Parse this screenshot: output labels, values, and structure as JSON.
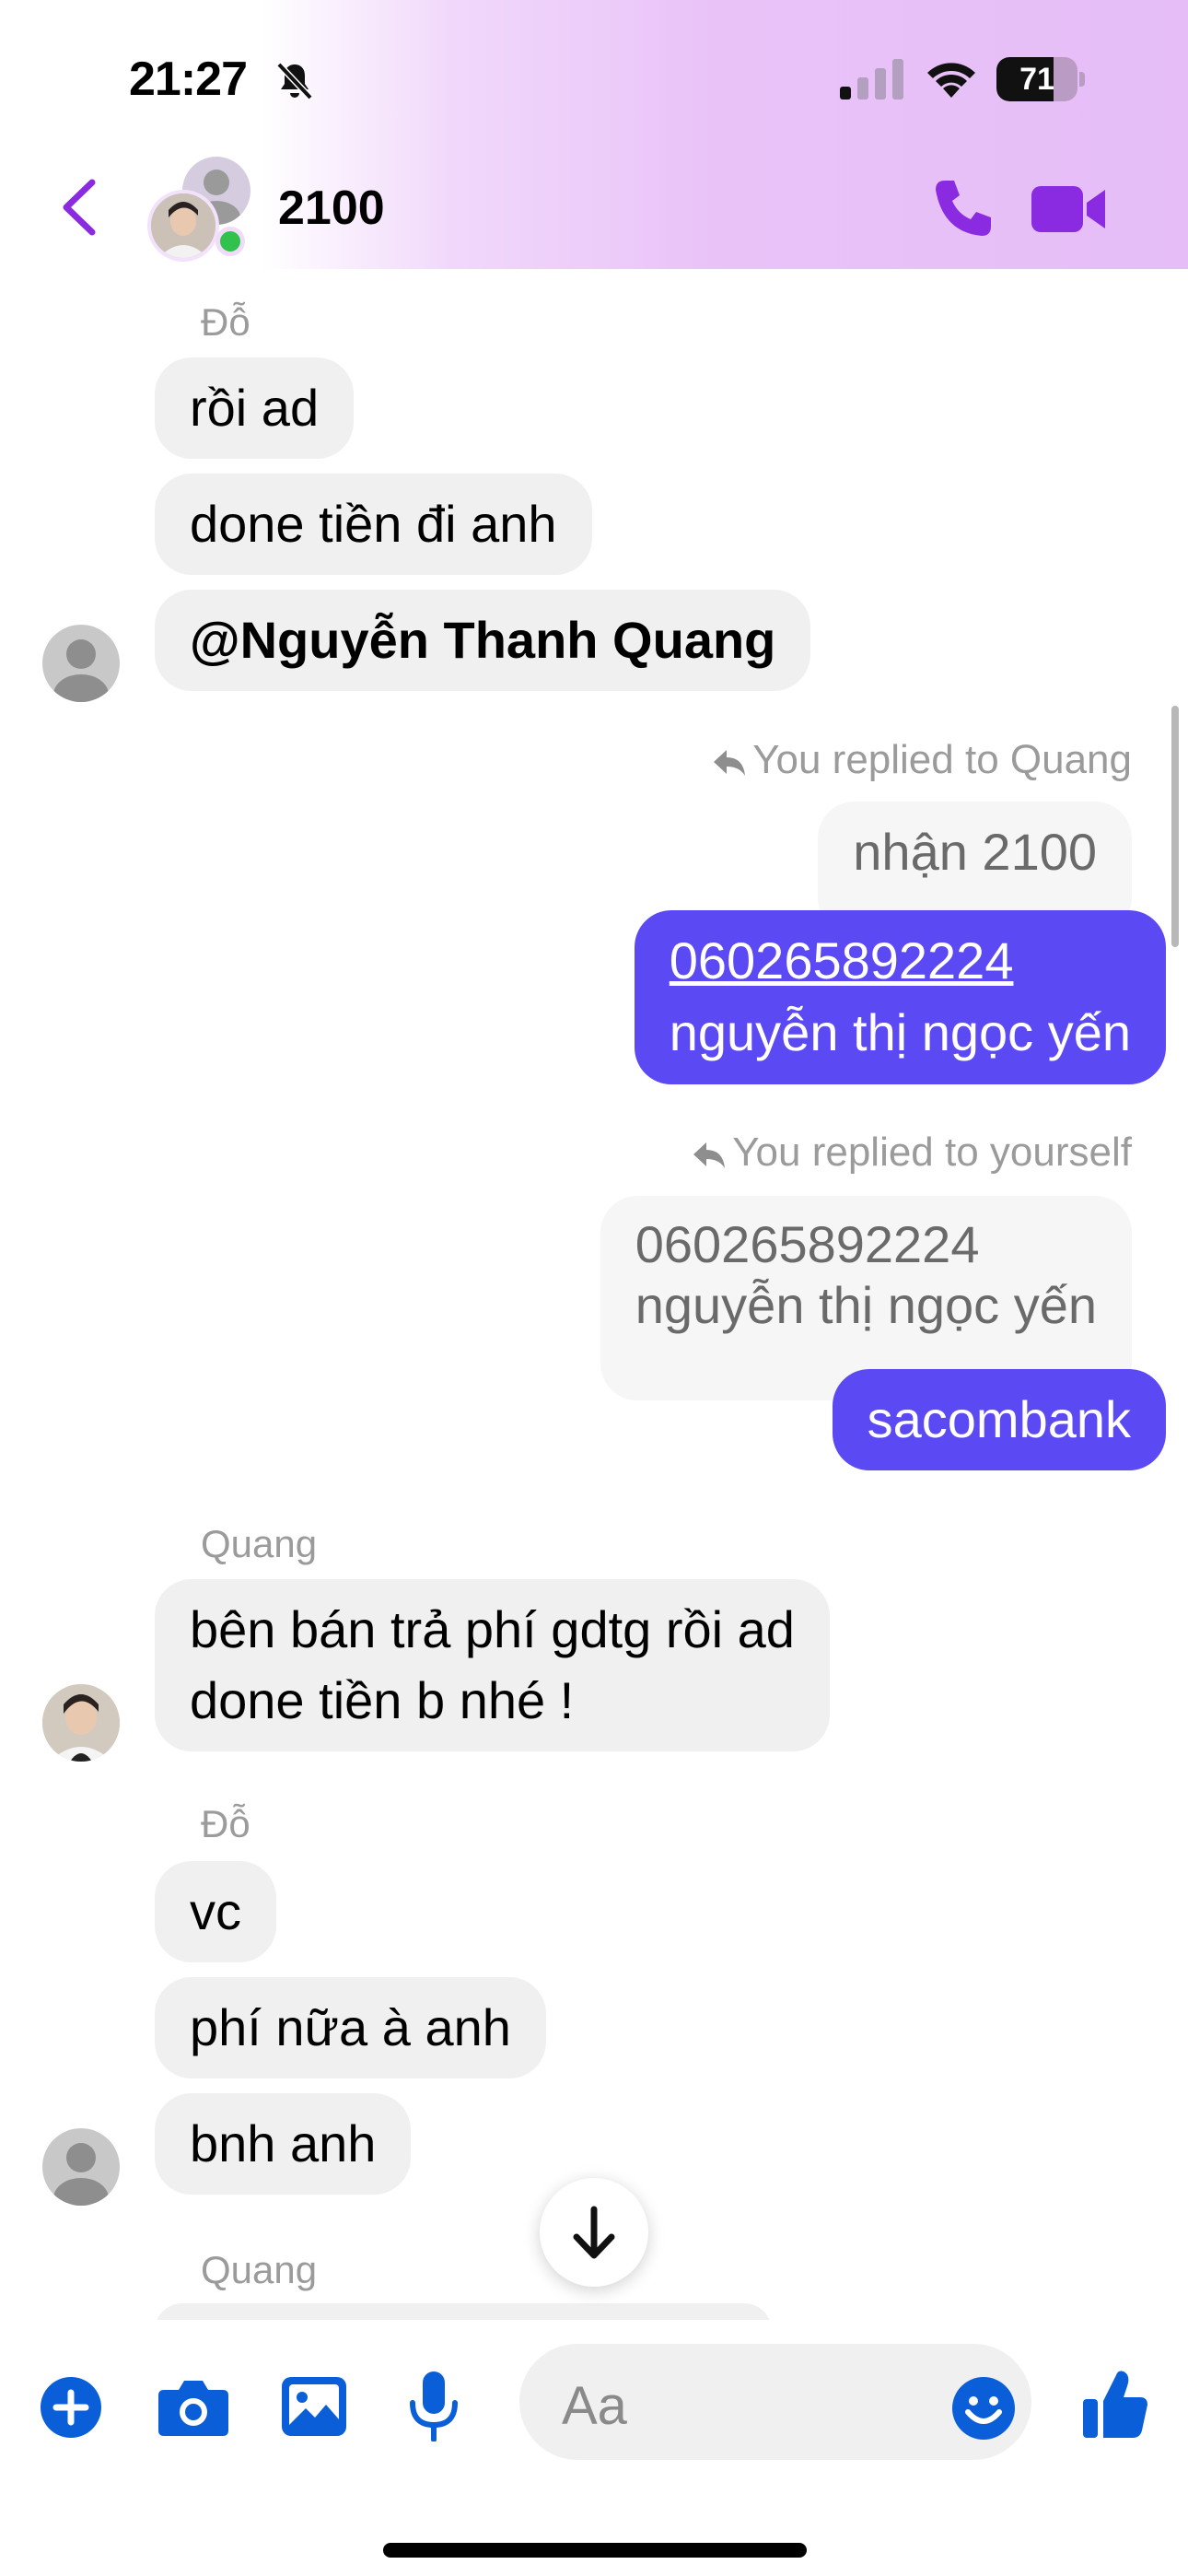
{
  "status_bar": {
    "time": "21:27",
    "battery_level": "71",
    "battery_fraction": 0.71
  },
  "header": {
    "title": "2100",
    "accent_color": "#8a2be2"
  },
  "messages": {
    "sender_do_1": "Đỗ",
    "do_msg_1": "rồi ad",
    "do_msg_2": "done tiền đi anh",
    "do_msg_3": "@Nguyễn Thanh Quang",
    "reply_note_1": "You replied to Quang",
    "quoted_1": "nhận 2100",
    "my_msg_1_line1": "060265892224",
    "my_msg_1_line2": "nguyễn thị ngọc yến",
    "reply_note_2": "You replied to yourself",
    "quoted_2_line1": "060265892224",
    "quoted_2_line2": "nguyễn thị ngọc yến",
    "my_msg_2": "sacombank",
    "sender_quang_1": "Quang",
    "quang_msg_1_line1": "bên bán trả phí gdtg rồi ad",
    "quang_msg_1_line2": "done tiền b nhé !",
    "sender_do_2": "Đỗ",
    "do_msg_4": "vc",
    "do_msg_5": "phí nữa à anh",
    "do_msg_6": "bnh anh",
    "sender_quang_2": "Quang"
  },
  "composer": {
    "placeholder": "Aa"
  },
  "colors": {
    "outgoing_bubble": "#5b49f4",
    "incoming_bubble": "#f0f0f0",
    "composer_icons": "#0a5ed8",
    "header_icons": "#8a2be2"
  },
  "icons": [
    "bell-slash-icon",
    "signal-icon",
    "wifi-icon",
    "battery-icon",
    "back-chevron-icon",
    "phone-icon",
    "video-camera-icon",
    "reply-arrow-icon",
    "arrow-down-icon",
    "plus-icon",
    "camera-icon",
    "image-icon",
    "microphone-icon",
    "emoji-icon",
    "thumbs-up-icon"
  ]
}
